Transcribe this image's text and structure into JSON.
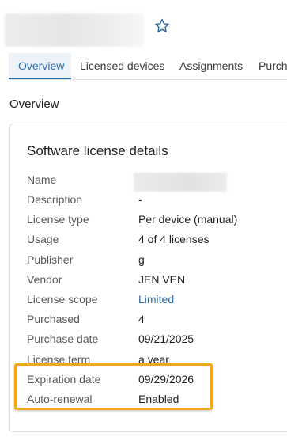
{
  "header": {
    "title": ""
  },
  "tabs": [
    {
      "label": "Overview",
      "active": true
    },
    {
      "label": "Licensed devices",
      "active": false
    },
    {
      "label": "Assignments",
      "active": false
    },
    {
      "label": "Purcha",
      "active": false
    }
  ],
  "section_title": "Overview",
  "card": {
    "title": "Software license details",
    "rows": [
      {
        "label": "Name",
        "value": ""
      },
      {
        "label": "Description",
        "value": "-"
      },
      {
        "label": "License type",
        "value": "Per device (manual)"
      },
      {
        "label": "Usage",
        "value": "4 of 4 licenses"
      },
      {
        "label": "Publisher",
        "value": "g"
      },
      {
        "label": "Vendor",
        "value": "JEN VEN"
      },
      {
        "label": "License scope",
        "value": "Limited"
      },
      {
        "label": "Purchased",
        "value": "4"
      },
      {
        "label": "Purchase date",
        "value": "09/21/2025"
      },
      {
        "label": "License term",
        "value": "a year"
      },
      {
        "label": "Expiration date",
        "value": "09/29/2026"
      },
      {
        "label": "Auto-renewal",
        "value": "Enabled"
      }
    ]
  },
  "icons": {
    "favorite": "star-outline-icon"
  },
  "colors": {
    "accent": "#2c6aa8",
    "highlight": "#f0a81c",
    "active_tab_bg": "#eef3fa"
  }
}
